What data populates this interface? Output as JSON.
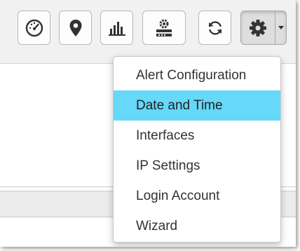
{
  "toolbar": {
    "buttons": [
      {
        "icon": "dashboard-gauge-icon"
      },
      {
        "icon": "map-marker-icon"
      },
      {
        "icon": "bar-chart-icon"
      },
      {
        "icon": "network-device-icon"
      },
      {
        "icon": "refresh-icon"
      }
    ],
    "settings": {
      "icon": "gear-icon",
      "caret": "caret-down-icon"
    }
  },
  "settings_menu": {
    "items": [
      {
        "label": "Alert Configuration"
      },
      {
        "label": "Date and Time",
        "highlighted": true
      },
      {
        "label": "Interfaces"
      },
      {
        "label": "IP Settings"
      },
      {
        "label": "Login Account"
      },
      {
        "label": "Wizard"
      }
    ]
  },
  "colors": {
    "highlight": "#66d8f8",
    "text": "#333333",
    "toolbar_bg": "#f1f1f1"
  }
}
